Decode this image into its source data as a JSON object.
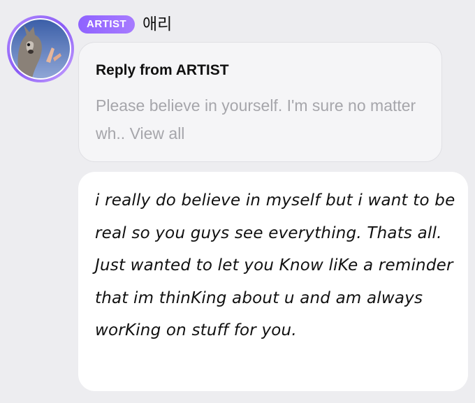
{
  "author": {
    "badge": "ARTIST",
    "name": "애리",
    "badge_color": "#8f63ff"
  },
  "reply": {
    "title": "Reply from ARTIST",
    "preview": "Please believe in yourself. I'm sure no matter wh..",
    "view_all": "View all"
  },
  "message": {
    "text": "i really do believe in myself but i want to be real so you guys see everything. Thats all. Just wanted to let you Know liKe a reminder that im thinKing about u and am always worKing on stuff for you."
  }
}
